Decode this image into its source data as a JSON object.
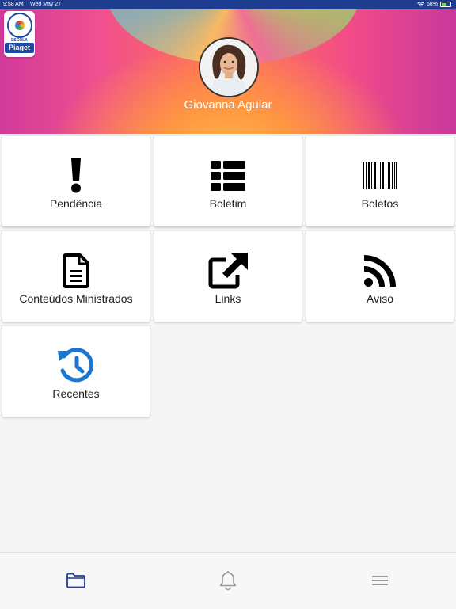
{
  "status_bar": {
    "time": "9:58 AM",
    "date": "Wed May 27",
    "battery": "68%"
  },
  "header": {
    "logo": {
      "school": "ESCOLA",
      "brand": "Piaget"
    },
    "user_name": "Giovanna Aguiar"
  },
  "tiles": [
    {
      "label": "Pendência",
      "icon": "exclamation-icon"
    },
    {
      "label": "Boletim",
      "icon": "table-list-icon"
    },
    {
      "label": "Boletos",
      "icon": "barcode-icon"
    },
    {
      "label": "Conteúdos Ministrados",
      "icon": "document-icon"
    },
    {
      "label": "Links",
      "icon": "external-link-icon"
    },
    {
      "label": "Aviso",
      "icon": "rss-icon"
    },
    {
      "label": "Recentes",
      "icon": "history-icon"
    }
  ],
  "bottom_nav": [
    {
      "icon": "folder-icon",
      "active": true
    },
    {
      "icon": "bell-icon",
      "active": false
    },
    {
      "icon": "menu-icon",
      "active": false
    }
  ],
  "colors": {
    "status_bar": "#1f3d8f",
    "accent_blue": "#1976d2",
    "nav_active": "#1c3f94",
    "nav_inactive": "#9a9a9a"
  }
}
